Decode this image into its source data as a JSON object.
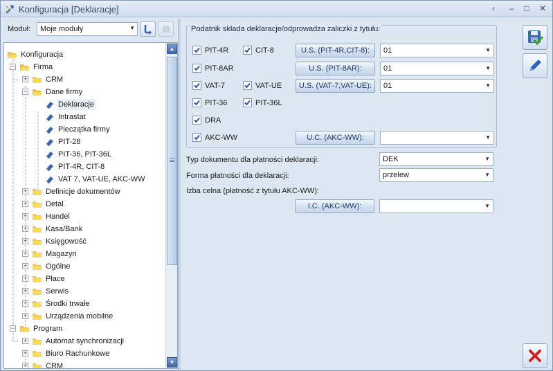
{
  "window": {
    "title": "Konfiguracja [Deklaracje]",
    "controls": [
      "‹",
      "–",
      "□",
      "✕"
    ]
  },
  "module": {
    "label": "Moduł:",
    "selected": "Moje moduły"
  },
  "tree": {
    "items": [
      {
        "label": "Konfiguracja",
        "level": 0,
        "icon": "folder-open-icon"
      },
      {
        "label": "Firma",
        "level": 1,
        "icon": "folder-open-icon",
        "expander": "−"
      },
      {
        "label": "CRM",
        "level": 2,
        "icon": "folder-icon",
        "expander": "+"
      },
      {
        "label": "Dane firmy",
        "level": 2,
        "icon": "folder-open-icon",
        "expander": "−"
      },
      {
        "label": "Deklaracje",
        "level": 3,
        "icon": "page-icon",
        "selected": true
      },
      {
        "label": "Intrastat",
        "level": 3,
        "icon": "page-icon"
      },
      {
        "label": "Pieczątka firmy",
        "level": 3,
        "icon": "page-icon"
      },
      {
        "label": "PIT-28",
        "level": 3,
        "icon": "page-icon"
      },
      {
        "label": "PIT-36, PIT-36L",
        "level": 3,
        "icon": "page-icon"
      },
      {
        "label": "PIT-4R, CIT-8",
        "level": 3,
        "icon": "page-icon"
      },
      {
        "label": "VAT 7, VAT-UE, AKC-WW",
        "level": 3,
        "icon": "page-icon"
      },
      {
        "label": "Definicje dokumentów",
        "level": 2,
        "icon": "folder-icon",
        "expander": "+"
      },
      {
        "label": "Detal",
        "level": 2,
        "icon": "folder-icon",
        "expander": "+"
      },
      {
        "label": "Handel",
        "level": 2,
        "icon": "folder-icon",
        "expander": "+"
      },
      {
        "label": "Kasa/Bank",
        "level": 2,
        "icon": "folder-icon",
        "expander": "+"
      },
      {
        "label": "Księgowość",
        "level": 2,
        "icon": "folder-icon",
        "expander": "+"
      },
      {
        "label": "Magazyn",
        "level": 2,
        "icon": "folder-icon",
        "expander": "+"
      },
      {
        "label": "Ogólne",
        "level": 2,
        "icon": "folder-icon",
        "expander": "+"
      },
      {
        "label": "Płace",
        "level": 2,
        "icon": "folder-icon",
        "expander": "+"
      },
      {
        "label": "Serwis",
        "level": 2,
        "icon": "folder-icon",
        "expander": "+"
      },
      {
        "label": "Środki trwałe",
        "level": 2,
        "icon": "folder-icon",
        "expander": "+"
      },
      {
        "label": "Urządzenia mobilne",
        "level": 2,
        "icon": "folder-icon",
        "expander": "+"
      },
      {
        "label": "Program",
        "level": 1,
        "icon": "folder-open-icon",
        "expander": "−"
      },
      {
        "label": "Automat synchronizacji",
        "level": 2,
        "icon": "folder-icon",
        "expander": "+"
      },
      {
        "label": "Biuro Rachunkowe",
        "level": 2,
        "icon": "folder-icon",
        "expander": "+"
      },
      {
        "label": "CRM",
        "level": 2,
        "icon": "folder-icon",
        "expander": "+"
      }
    ]
  },
  "group": {
    "title": "Podatnik składa deklaracje/odprowadza zaliczki z tytułu:"
  },
  "checkboxes": {
    "pit4r": {
      "label": "PIT-4R",
      "checked": true
    },
    "cit8": {
      "label": "CIT-8",
      "checked": true
    },
    "pit8ar": {
      "label": "PIT-8AR",
      "checked": true
    },
    "vat7": {
      "label": "VAT-7",
      "checked": true
    },
    "vatue": {
      "label": "VAT-UE",
      "checked": true
    },
    "pit36": {
      "label": "PIT-36",
      "checked": true
    },
    "pit36l": {
      "label": "PIT-36L",
      "checked": true
    },
    "dra": {
      "label": "DRA",
      "checked": true
    },
    "akcww": {
      "label": "AKC-WW",
      "checked": true
    }
  },
  "office_buttons": {
    "us_pit4r": "U.S. (PIT-4R,CIT-8):",
    "us_pit8ar": "U.S. (PIT-8AR):",
    "us_vat": "U.S. (VAT-7,VAT-UE):",
    "uc_akc": "U.C. (AKC-WW):",
    "ic_akc": "I.C. (AKC-WW):"
  },
  "office_values": {
    "us_pit4r": "01",
    "us_pit8ar": "01",
    "us_vat": "01",
    "uc_akc": "",
    "ic_akc": ""
  },
  "payment": {
    "doc_type_label": "Typ dokumentu dla płatności deklaracji:",
    "doc_type_value": "DEK",
    "form_label": "Forma płatności dla deklaracji:",
    "form_value": "przelew",
    "customs_label": "Izba celna (płatność z tytułu AKC-WW):"
  },
  "colors": {
    "accent": "#3e66a6",
    "check": "#2f55b0",
    "cancel": "#d42020"
  }
}
